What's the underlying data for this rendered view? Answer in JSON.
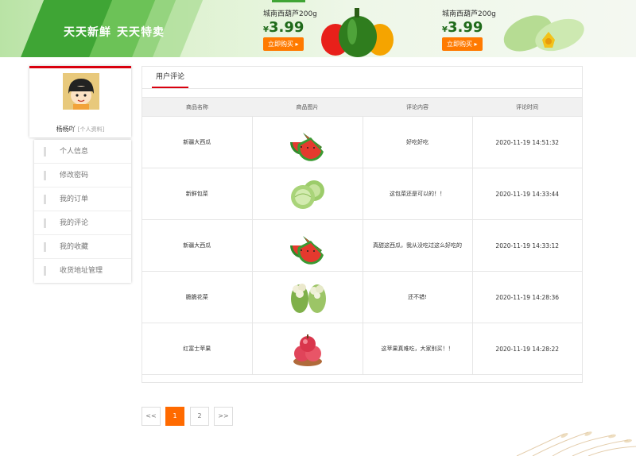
{
  "banner": {
    "slogan1": "天天新鲜",
    "slogan2": "天天特卖",
    "promos": [
      {
        "title": "城南西葫芦200g",
        "currency": "¥",
        "price": "3.99",
        "button": "立即购买 ▸",
        "image": "pepper-icon"
      },
      {
        "title": "城南西葫芦200g",
        "currency": "¥",
        "price": "3.99",
        "button": "立即购买 ▸",
        "image": "zucchini-icon"
      }
    ]
  },
  "profile": {
    "username": "杨杨吖",
    "info_link": "[个人资料]",
    "avatar": "cartoon-avatar-icon"
  },
  "sidebar": {
    "items": [
      {
        "label": "个人信息"
      },
      {
        "label": "修改密码"
      },
      {
        "label": "我的订单"
      },
      {
        "label": "我的评论"
      },
      {
        "label": "我的收藏"
      },
      {
        "label": "收货地址管理"
      }
    ]
  },
  "reviews": {
    "tab_label": "用户评论",
    "columns": [
      "商品名称",
      "商品图片",
      "评论内容",
      "评论时间"
    ],
    "rows": [
      {
        "name": "新疆大西瓜",
        "image": "watermelon-icon",
        "comment": "好吃好吃",
        "time": "2020-11-19 14:51:32"
      },
      {
        "name": "新鲜包菜",
        "image": "cabbage-icon",
        "comment": "这包菜还是可以的！！",
        "time": "2020-11-19 14:33:44"
      },
      {
        "name": "新疆大西瓜",
        "image": "watermelon-icon",
        "comment": "真甜这西瓜，我从没吃过这么好吃的",
        "time": "2020-11-19 14:33:12"
      },
      {
        "name": "脆脆花菜",
        "image": "cauliflower-icon",
        "comment": "还不错!",
        "time": "2020-11-19 14:28:36"
      },
      {
        "name": "红富士苹果",
        "image": "apple-icon",
        "comment": "这苹果真难吃，大家别买！！",
        "time": "2020-11-19 14:28:22"
      }
    ]
  },
  "pagination": {
    "prev": "<<",
    "pages": [
      "1",
      "2"
    ],
    "current": "1",
    "next": ">>"
  },
  "colors": {
    "accent_red": "#d9000e",
    "accent_orange": "#ff6a00",
    "brand_green": "#3fa535"
  }
}
